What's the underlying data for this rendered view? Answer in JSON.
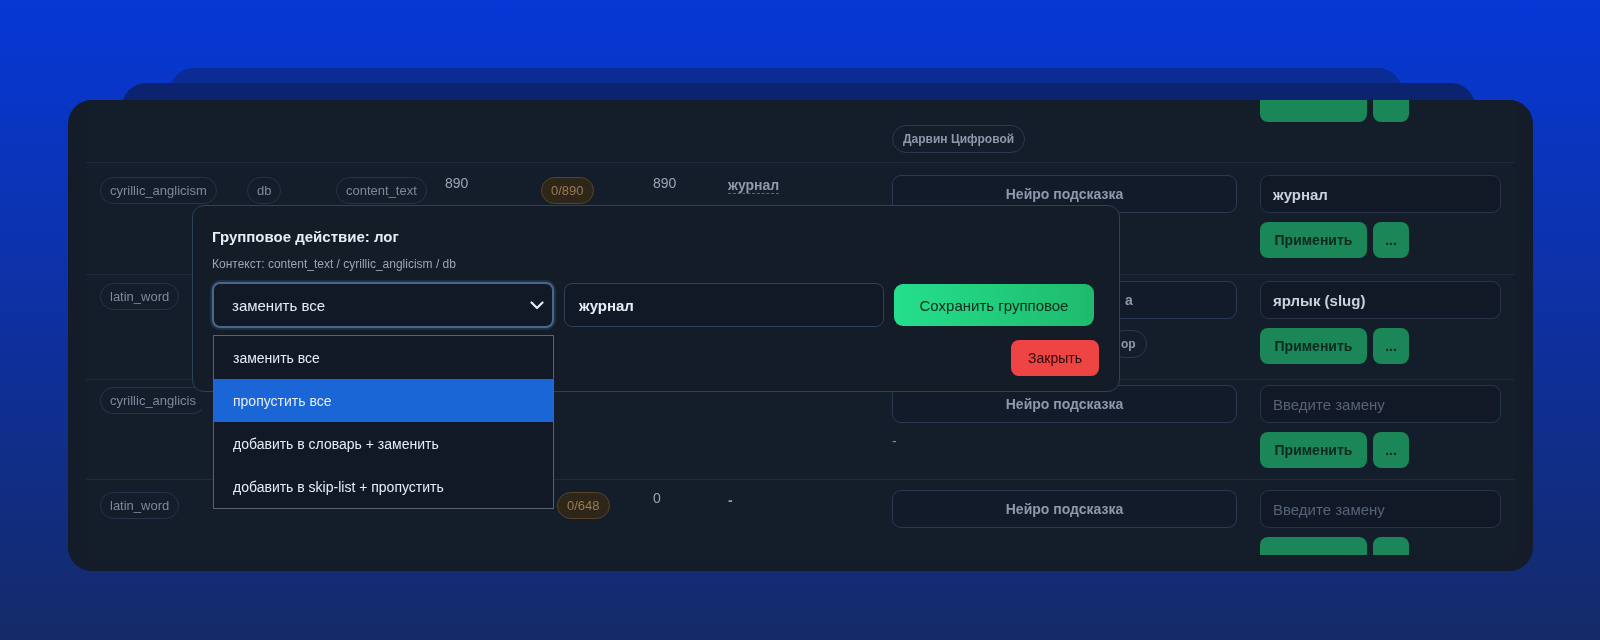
{
  "rows": [
    {
      "chips": [
        "Дарвин Цифровой"
      ],
      "actions_clipped": true
    },
    {
      "category": "cyrillic_anglicism",
      "source": "db",
      "field": "content_text",
      "count": "890",
      "badge": "0/890",
      "count_2": "890",
      "term": "журнал",
      "suggestion_button": "Нейро подсказка",
      "replacement": {
        "value": "журнал"
      },
      "actions": {
        "apply": "Применить",
        "more": "..."
      }
    },
    {
      "category": "latin_word",
      "suggestion_button": "а",
      "suggestion_partial": true,
      "chips": [
        "ор"
      ],
      "replacement": {
        "value": "ярлык (slug)"
      },
      "actions": {
        "apply": "Применить",
        "more": "..."
      }
    },
    {
      "category": "cyrillic_anglicis",
      "suggestion_button": "Нейро подсказка",
      "suggestion_note": "-",
      "replacement": {
        "placeholder": "Введите замену"
      },
      "actions": {
        "apply": "Применить",
        "more": "..."
      }
    },
    {
      "category": "latin_word",
      "badge": "0/648",
      "count_2": "0",
      "term": "-",
      "suggestion_button": "Нейро подсказка",
      "replacement": {
        "placeholder": "Введите замену"
      },
      "actions_clipped": true
    }
  ],
  "modal": {
    "title": "Групповое действие: лог",
    "context": "Контекст: content_text / cyrillic_anglicism / db",
    "select": {
      "value": "заменить все",
      "expanded": true,
      "options": [
        {
          "label": "заменить все",
          "highlighted": false
        },
        {
          "label": "пропустить все",
          "highlighted": true
        },
        {
          "label": "добавить в словарь + заменить",
          "highlighted": false
        },
        {
          "label": "добавить в skip-list + пропустить",
          "highlighted": false
        }
      ]
    },
    "input": {
      "value": "журнал"
    },
    "save_button": "Сохранить групповое",
    "close_button": "Закрыть"
  }
}
